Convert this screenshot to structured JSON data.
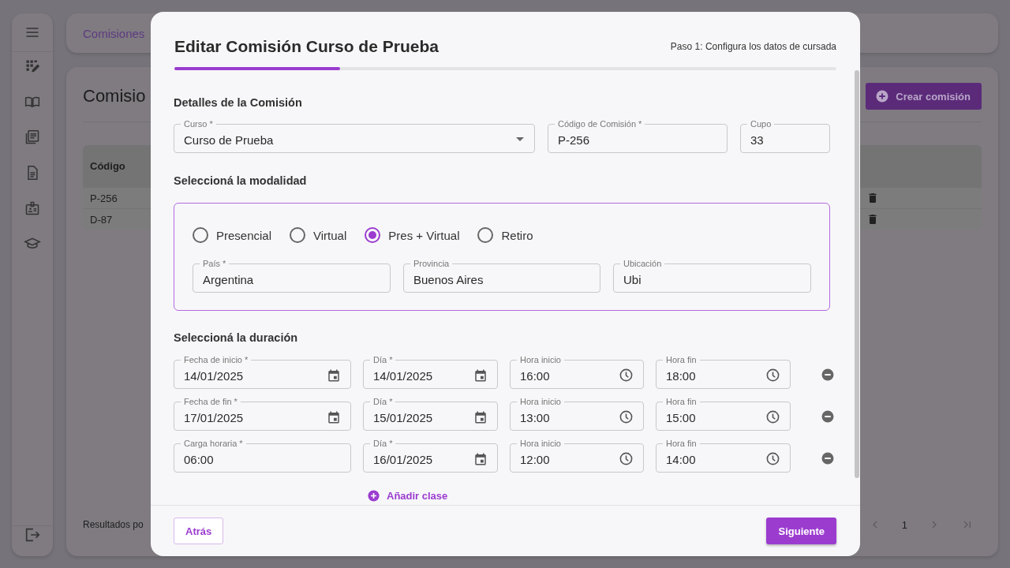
{
  "page": {
    "breadcrumb": "Comisiones",
    "title": "Comisio",
    "create_button": "Crear comisión",
    "table": {
      "columns": [
        "Código"
      ],
      "rows": [
        [
          "P-256"
        ],
        [
          "D-87"
        ]
      ]
    },
    "footer_text": "Resultados po",
    "pagination": {
      "page": "1"
    }
  },
  "modal": {
    "title": "Editar Comisión Curso de Prueba",
    "step": "Paso 1: Configura los datos de cursada",
    "progress": {
      "level": 0.25
    },
    "details": {
      "heading": "Detalles de la Comisión",
      "fields": [
        {
          "label": "Curso *",
          "value": "Curso de Prueba",
          "kind": "select"
        },
        {
          "label": "Código de Comisión *",
          "value": "P-256",
          "kind": "text"
        },
        {
          "label": "Cupo",
          "value": "33",
          "kind": "text"
        }
      ]
    },
    "modality": {
      "heading": "Seleccioná la modalidad",
      "options": [
        {
          "label": "Presencial",
          "selected": false
        },
        {
          "label": "Virtual",
          "selected": false
        },
        {
          "label": "Pres + Virtual",
          "selected": true
        },
        {
          "label": "Retiro",
          "selected": false
        }
      ],
      "fields": [
        {
          "label": "País *",
          "value": "Argentina",
          "kind": "text"
        },
        {
          "label": "Provincia",
          "value": "Buenos Aires",
          "kind": "text"
        },
        {
          "label": "Ubicación",
          "value": "Ubi",
          "kind": "text"
        }
      ]
    },
    "duration": {
      "heading": "Seleccioná la duración",
      "rows": [
        {
          "fields": [
            {
              "label": "Fecha de inicio *",
              "value": "14/01/2025",
              "kind": "date"
            },
            {
              "label": "Día *",
              "value": "14/01/2025",
              "kind": "date"
            },
            {
              "label": "Hora inicio",
              "value": "16:00",
              "kind": "time"
            },
            {
              "label": "Hora fin",
              "value": "18:00",
              "kind": "time"
            }
          ]
        },
        {
          "fields": [
            {
              "label": "Fecha de fin *",
              "value": "17/01/2025",
              "kind": "date"
            },
            {
              "label": "Día *",
              "value": "15/01/2025",
              "kind": "date"
            },
            {
              "label": "Hora inicio",
              "value": "13:00",
              "kind": "time"
            },
            {
              "label": "Hora fin",
              "value": "15:00",
              "kind": "time"
            }
          ]
        },
        {
          "fields": [
            {
              "label": "Carga horaria *",
              "value": "06:00",
              "kind": "text"
            },
            {
              "label": "Día *",
              "value": "16/01/2025",
              "kind": "date"
            },
            {
              "label": "Hora inicio",
              "value": "12:00",
              "kind": "time"
            },
            {
              "label": "Hora fin",
              "value": "14:00",
              "kind": "time"
            }
          ]
        }
      ],
      "add_button": "Añadir clase"
    },
    "buttons": {
      "back": "Atrás",
      "next": "Siguiente"
    }
  }
}
